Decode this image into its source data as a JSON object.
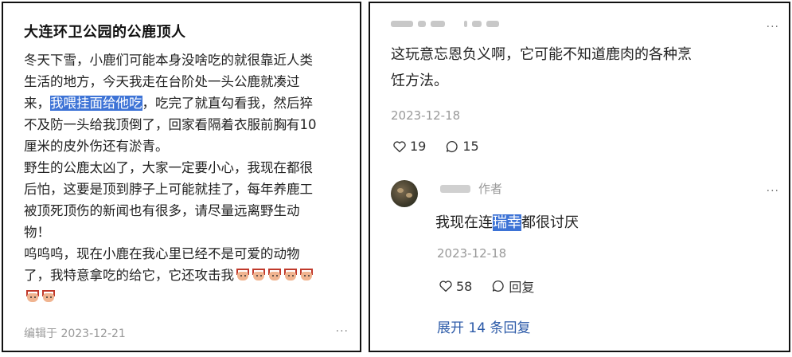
{
  "post": {
    "title": "大连环卫公园的公鹿顶人",
    "line1": "冬天下雪，小鹿们可能本身没啥吃的就很靠近人类",
    "line2": "生活的地方，今天我走在台阶处一头公鹿就凑过",
    "line3_pre": "来，",
    "line3_hl": "我喂挂面给他吃",
    "line3_post": "，吃完了就直勾看我，然后猝",
    "line4": "不及防一头给我顶倒了，回家看隔着衣服前胸有10",
    "line5": "厘米的皮外伤还有淤青。",
    "line6": "野生的公鹿太凶了，大家一定要小心，我现在都很",
    "line7": "后怕，这要是顶到脖子上可能就挂了，每年养鹿工",
    "line8": "被顶死顶伤的新闻也有很多，请尽量远离野生动",
    "line9": "物！",
    "line10": "呜呜呜，现在小鹿在我心里已经不是可爱的动物",
    "line11": "了，我特意拿吃的给它，它还攻击我",
    "footer": "编辑于 2023-12-21",
    "more": "···",
    "emoji_icon": "deer-face-emoji"
  },
  "comment1": {
    "text_line1": "这玩意忘恩负义啊，它可能不知道鹿肉的各种烹",
    "text_line2": "饪方法。",
    "date": "2023-12-18",
    "likes": "19",
    "replies": "15",
    "more": "···"
  },
  "comment2": {
    "author_tag": "作者",
    "text_pre": "我现在连",
    "text_hl": "瑞幸",
    "text_post": "都很讨厌",
    "date": "2023-12-18",
    "likes": "58",
    "reply_label": "回复",
    "more": "···"
  },
  "expand_label": "展开 14 条回复",
  "colors": {
    "highlight": "#3d73d6",
    "link": "#2c5aa8",
    "muted": "#999999"
  }
}
